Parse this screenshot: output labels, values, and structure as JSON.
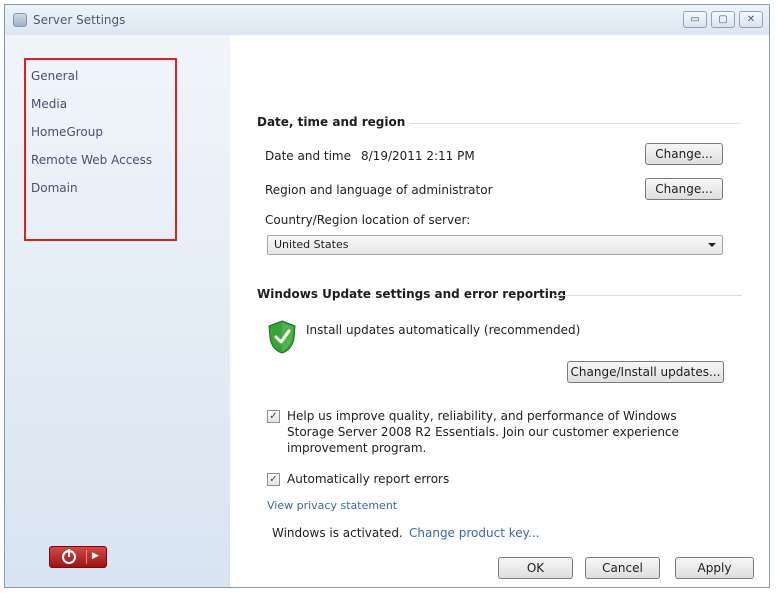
{
  "window": {
    "title": "Server Settings",
    "controls": {
      "minimize": "▭",
      "maximize": "▢",
      "close": "✕"
    }
  },
  "sidebar": {
    "items": [
      {
        "label": "General",
        "selected": true
      },
      {
        "label": "Media",
        "selected": false
      },
      {
        "label": "HomeGroup",
        "selected": false
      },
      {
        "label": "Remote Web Access",
        "selected": false
      },
      {
        "label": "Domain",
        "selected": false
      }
    ]
  },
  "date_section": {
    "title": "Date, time and region",
    "datetime_label": "Date and time",
    "datetime_value": "8/19/2011 2:11 PM",
    "change_label_1": "Change...",
    "region_label": "Region and language of administrator",
    "change_label_2": "Change...",
    "country_label": "Country/Region location of server:",
    "country_value": "United States"
  },
  "update_section": {
    "title": "Windows Update settings and error reporting",
    "status_text": "Install updates automatically (recommended)",
    "install_button": "Change/Install updates...",
    "improve_text": "Help us improve quality, reliability, and performance of Windows Storage Server 2008 R2 Essentials. Join our customer experience improvement program.",
    "improve_checked": true,
    "report_text": "Automatically report errors",
    "report_checked": true,
    "privacy_link": "View privacy statement",
    "activation_text": "Windows is activated.",
    "product_key_link": "Change product key..."
  },
  "footer": {
    "ok": "OK",
    "cancel": "Cancel",
    "apply": "Apply"
  },
  "icons": {
    "shield": "green-shield-check-icon",
    "power": "power-icon"
  }
}
